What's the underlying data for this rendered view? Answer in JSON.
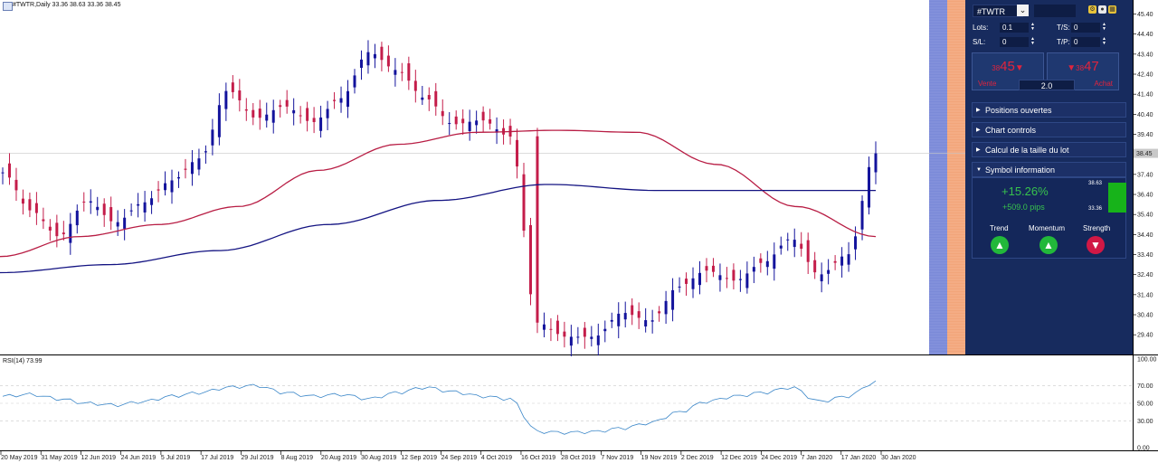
{
  "header": {
    "symbol_info": "#TWTR,Daily  33.36 38.63 33.36 38.45"
  },
  "rsi": {
    "label": "RSI(14) 73.99",
    "levels": [
      "100.00",
      "70.00",
      "50.00",
      "30.00",
      "0.00"
    ]
  },
  "price_axis": [
    "45.40",
    "44.40",
    "43.40",
    "42.40",
    "41.40",
    "40.40",
    "39.40",
    "37.40",
    "36.40",
    "35.40",
    "34.40",
    "33.40",
    "32.40",
    "31.40",
    "30.40",
    "29.40"
  ],
  "current_price_tag": "38.45",
  "date_axis": [
    "20 May 2019",
    "31 May 2019",
    "12 Jun 2019",
    "24 Jun 2019",
    "5 Jul 2019",
    "17 Jul 2019",
    "29 Jul 2019",
    "8 Aug 2019",
    "20 Aug 2019",
    "30 Aug 2019",
    "12 Sep 2019",
    "24 Sep 2019",
    "4 Oct 2019",
    "16 Oct 2019",
    "28 Oct 2019",
    "7 Nov 2019",
    "19 Nov 2019",
    "2 Dec 2019",
    "12 Dec 2019",
    "24 Dec 2019",
    "7 Jan 2020",
    "17 Jan 2020",
    "30 Jan 2020"
  ],
  "colors": {
    "bull": "#13139c",
    "bear": "#c41d4a",
    "ma_fast": "#b81d44",
    "ma_slow": "#131382",
    "rsi_line": "#3a86c8",
    "panel_bg": "#172b5e",
    "green": "#37c24d",
    "red": "#e0243d"
  },
  "chart_data": {
    "type": "candlestick",
    "ma_fast_values": [
      33.3,
      34.3,
      34.9,
      35.8,
      37.6,
      38.9,
      39.5,
      39.6,
      39.5,
      37.9,
      35.8,
      34.3
    ],
    "ma_slow_values": [
      32.5,
      32.9,
      33.6,
      34.9,
      36.1,
      36.9,
      36.6,
      36.6,
      36.6
    ],
    "close_series": [
      37.5,
      35.6,
      34.3,
      36.1,
      35.0,
      36.0,
      37.1,
      38.2,
      41.6,
      40.2,
      40.8,
      40.0,
      41.2,
      43.5,
      42.6,
      41.2,
      39.9,
      40.1,
      39.3,
      30.0,
      29.3,
      29.3,
      30.5,
      30.1,
      31.8,
      32.6,
      32.1,
      33.0,
      34.2,
      32.4,
      33.4,
      38.45
    ],
    "rsi_values": [
      58,
      60,
      55,
      50,
      48,
      52,
      58,
      62,
      68,
      70,
      62,
      58,
      60,
      55,
      62,
      68,
      63,
      58,
      55,
      18,
      17,
      18,
      22,
      28,
      40,
      52,
      58,
      62,
      68,
      52,
      58,
      74
    ]
  },
  "panel": {
    "symbol": "#TWTR",
    "dropdown_arrow": "⌄",
    "lots_label": "Lots:",
    "lots_value": "0.1",
    "ts_label": "T/S:",
    "ts_value": "0",
    "sl_label": "S/L:",
    "sl_value": "0",
    "tp_label": "T/P:",
    "tp_value": "0",
    "sell_small": "38",
    "sell_big": "45",
    "sell_label": "Vente",
    "buy_small": "38",
    "buy_big": "47",
    "buy_label": "Achat",
    "quantity": "2.0",
    "sections": [
      "Positions ouvertes",
      "Chart controls",
      "Calcul de la taille du lot",
      "Symbol information"
    ],
    "pct_change": "+15.26%",
    "pips": "+509.0 pips",
    "high": "38.63",
    "low": "33.36",
    "indicators": [
      {
        "label": "Trend",
        "dir": "up"
      },
      {
        "label": "Momentum",
        "dir": "up"
      },
      {
        "label": "Strength",
        "dir": "down"
      }
    ]
  }
}
